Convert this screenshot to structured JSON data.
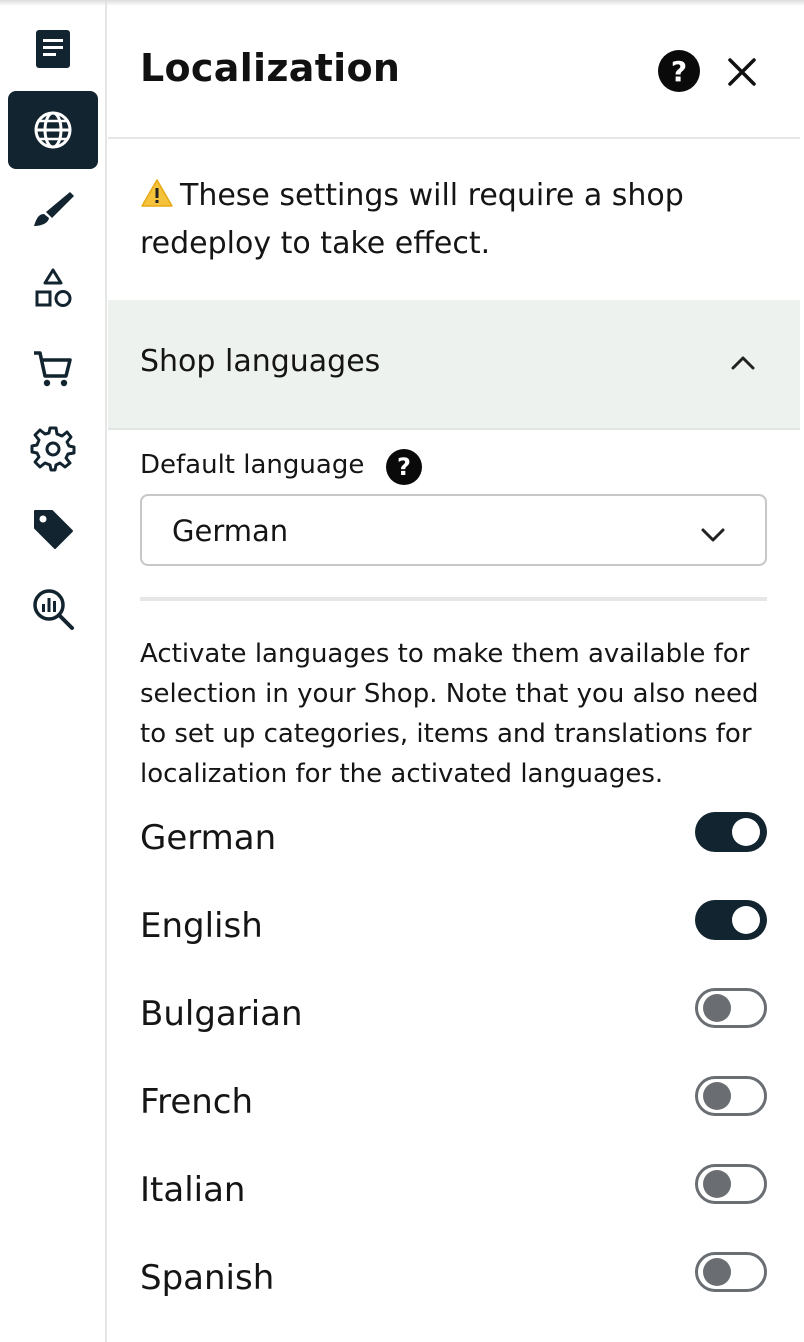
{
  "panel": {
    "title": "Localization",
    "help_icon": "question-circle-icon",
    "close_icon": "close-icon"
  },
  "warning": {
    "icon": "warning-triangle-icon",
    "text": "These settings will require a shop redeploy to take effect."
  },
  "section": {
    "title": "Shop languages",
    "expanded": true
  },
  "default_language": {
    "label": "Default language",
    "value": "German"
  },
  "description": "Activate languages to make them available for selection in your Shop. Note that you also need to set up categories, items and translations for localization for the activated languages.",
  "languages": [
    {
      "name": "German",
      "enabled": true
    },
    {
      "name": "English",
      "enabled": true
    },
    {
      "name": "Bulgarian",
      "enabled": false
    },
    {
      "name": "French",
      "enabled": false
    },
    {
      "name": "Italian",
      "enabled": false
    },
    {
      "name": "Spanish",
      "enabled": false
    }
  ],
  "sidebar": {
    "items": [
      {
        "icon": "document-icon",
        "active": false
      },
      {
        "icon": "globe-icon",
        "active": true
      },
      {
        "icon": "brush-icon",
        "active": false
      },
      {
        "icon": "shapes-icon",
        "active": false
      },
      {
        "icon": "cart-icon",
        "active": false
      },
      {
        "icon": "gear-icon",
        "active": false
      },
      {
        "icon": "tag-icon",
        "active": false
      },
      {
        "icon": "analytics-search-icon",
        "active": false
      }
    ]
  },
  "colors": {
    "accent": "#12242f",
    "section_bg": "#eef2ee",
    "toggle_off": "#6a6e73"
  }
}
